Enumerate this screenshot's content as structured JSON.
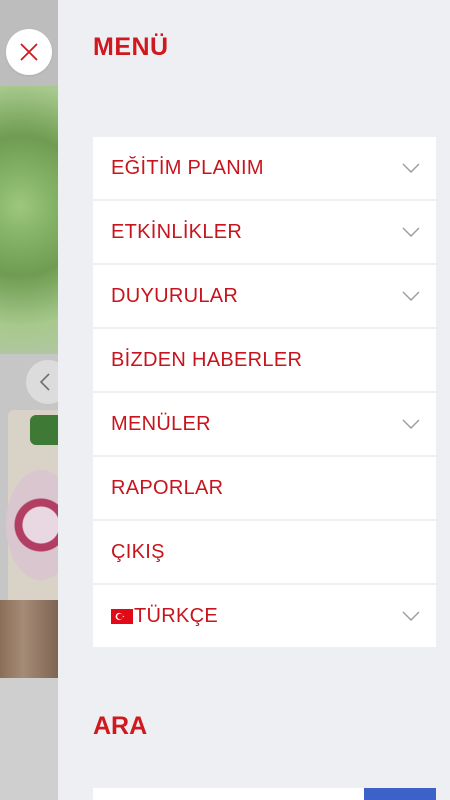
{
  "drawer": {
    "title": "MENÜ",
    "items": [
      {
        "label": "EĞİTİM PLANIM",
        "expandable": true
      },
      {
        "label": "ETKİNLİKLER",
        "expandable": true
      },
      {
        "label": "DUYURULAR",
        "expandable": true
      },
      {
        "label": "BİZDEN HABERLER",
        "expandable": false
      },
      {
        "label": "MENÜLER",
        "expandable": true
      },
      {
        "label": "RAPORLAR",
        "expandable": false
      },
      {
        "label": "ÇIKIŞ",
        "expandable": false
      },
      {
        "label": "TÜRKÇE",
        "expandable": true,
        "icon": "turkey-flag-icon"
      }
    ],
    "search": {
      "title": "ARA",
      "placeholder": ""
    }
  },
  "colors": {
    "accent": "#d0181f",
    "drawer_bg": "#eeeff3",
    "search_button": "#3c61c8"
  },
  "icons": {
    "close": "close-icon",
    "chevron": "chevron-down-icon",
    "carousel_prev": "chevron-left-icon"
  }
}
